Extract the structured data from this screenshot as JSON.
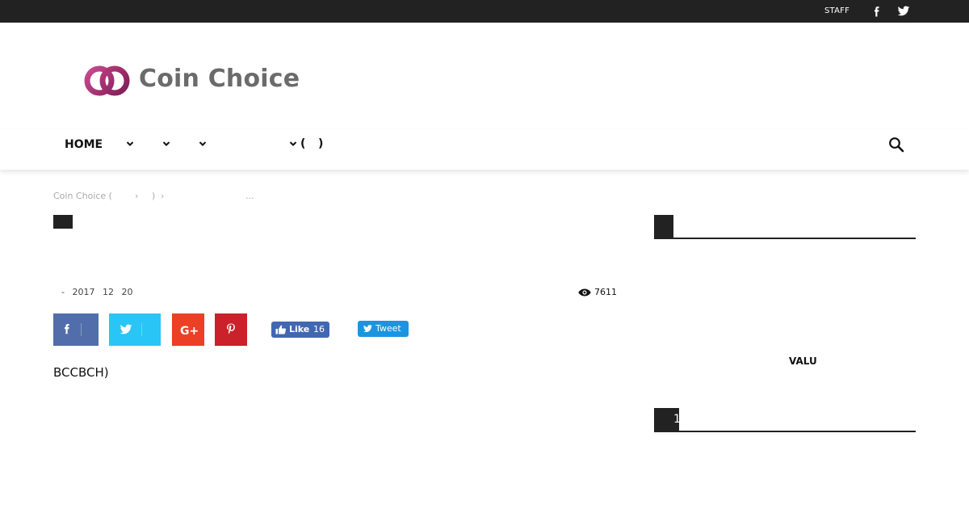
{
  "topbar": {
    "staff_label": "STAFF",
    "social_icons": [
      "facebook-icon",
      "twitter-icon"
    ]
  },
  "logo": {
    "text": "Coin Choice",
    "colors": {
      "ring_left": "#b03a7e",
      "ring_right": "#a0306f",
      "text": "#6b6b6b"
    }
  },
  "nav": {
    "home_label": "HOME",
    "paren_open": "(",
    "paren_close": ")",
    "dropdown_icons": [
      "chevron-down-icon",
      "chevron-down-icon",
      "chevron-down-icon",
      "chevron-down-icon"
    ],
    "search_icon": "search-icon"
  },
  "breadcrumbs": {
    "site_label": "Coin Choice (",
    "sep1": "›",
    "close_paren": ")",
    "sep2": "›",
    "ellipsis": "..."
  },
  "article": {
    "date": {
      "dash": "-",
      "year": "2017",
      "month": "12",
      "day": "20"
    },
    "views": "7611",
    "body": "BCCBCH)"
  },
  "share": {
    "buttons": [
      "facebook-icon",
      "twitter-icon",
      "google-plus-icon",
      "pinterest-icon"
    ],
    "colors": {
      "facebook": "#516eab",
      "twitter": "#29c5f6",
      "googleplus": "#eb4026",
      "pinterest": "#ca212a"
    },
    "like_label": "Like",
    "like_count": "16",
    "tweet_label": "Tweet"
  },
  "sidebar": {
    "valu_label": "VALU",
    "block2_tab": "1"
  }
}
